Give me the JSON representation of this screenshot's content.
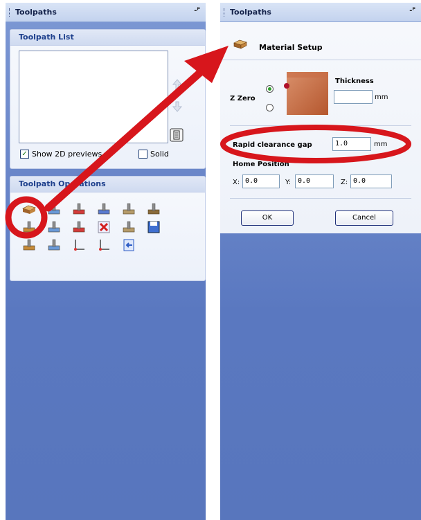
{
  "left_panel": {
    "title": "Toolpaths",
    "pin_glyph": "-ᴾ",
    "toolpath_list": {
      "heading": "Toolpath List",
      "show_2d_preview": {
        "label": "Show 2D previews",
        "checked": true
      },
      "solid": {
        "label": "Solid",
        "checked": false
      }
    },
    "operations": {
      "heading": "Toolpath Operations",
      "icons": [
        "material-setup-icon",
        "profile-toolpath-icon",
        "pocket-toolpath-icon",
        "drilling-toolpath-icon",
        "vcarve-toolpath-icon",
        "texture-toolpath-icon",
        "chamfer-toolpath-icon",
        "edit-toolpath-icon",
        "calculate-all-icon",
        "delete-toolpath-icon",
        "time-estimate-icon",
        "save-toolpath-icon",
        "fluting-toolpath-icon",
        "preview-icon",
        "origin-icon",
        "axis-icon",
        "import-icon"
      ]
    }
  },
  "right_panel": {
    "title": "Toolpaths",
    "pin_glyph": "-ᴾ",
    "material_setup": {
      "heading": "Material Setup",
      "z_zero_label": "Z Zero",
      "thickness_label": "Thickness",
      "thickness_value": "",
      "thickness_unit": "mm",
      "rapid_clearance_label": "Rapid clearance gap",
      "rapid_clearance_value": "1.0",
      "rapid_clearance_unit": "mm",
      "home_position_label": "Home Position",
      "x_label": "X:",
      "x_value": "0.0",
      "y_label": "Y:",
      "y_value": "0.0",
      "z_label": "Z:",
      "z_value": "0.0",
      "ok_label": "OK",
      "cancel_label": "Cancel"
    }
  },
  "colors": {
    "highlight_red": "#d7161c",
    "panel_blue": "#5a78c0",
    "header_blue": "#1d3f8c"
  }
}
